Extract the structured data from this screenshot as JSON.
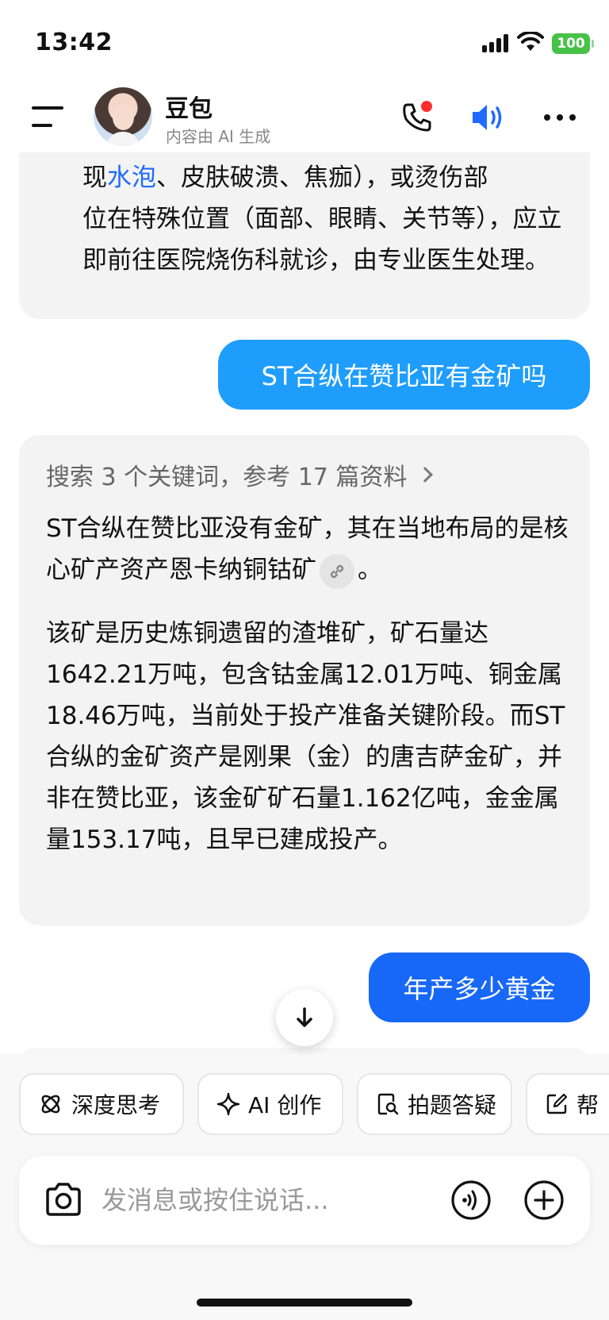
{
  "status_bar": {
    "time": "13:42",
    "battery": "100"
  },
  "header": {
    "bot_name": "豆包",
    "subtitle": "内容由 AI 生成"
  },
  "messages": {
    "ai_prev_tail": {
      "line1_a": "现",
      "line1_blue": "水泡",
      "line1_b": "、皮肤破溃、焦痂），或烫伤部",
      "rest": "位在特殊位置（面部、眼睛、关节等），应立即前往医院烧伤科就诊，由专业医生处理。"
    },
    "user_1": "ST合纵在赞比亚有金矿吗",
    "ai_1": {
      "search_summary": "搜索 3 个关键词，参考 17 篇资料",
      "para1_a": "ST合纵在赞比亚没有金矿，其在当地布局的是核心矿产资产恩卡纳铜钴矿",
      "para1_b": "。",
      "para2": "该矿是历史炼铜遗留的渣堆矿，矿石量达1642.21万吨，包含钴金属12.01万吨、铜金属18.46万吨，当前处于投产准备关键阶段。而ST合纵的金矿资产是刚果（金）的唐吉萨金矿，并非在赞比亚，该金矿矿石量1.162亿吨，金金属量153.17吨，且早已建成投产。"
    },
    "user_2": "年产多少黄金"
  },
  "chips": [
    {
      "label": "深度思考",
      "icon": "atom-icon"
    },
    {
      "label": "AI 创作",
      "icon": "sparkle-icon"
    },
    {
      "label": "拍题答疑",
      "icon": "photo-search-icon"
    },
    {
      "label": "帮",
      "icon": "edit-icon"
    }
  ],
  "composer": {
    "placeholder": "发消息或按住说话..."
  },
  "colors": {
    "user_bubble": "#1e9dfc",
    "user_bubble_2": "#1868f8",
    "ai_bubble": "#f3f3f3",
    "link_blue": "#1f6bff"
  }
}
